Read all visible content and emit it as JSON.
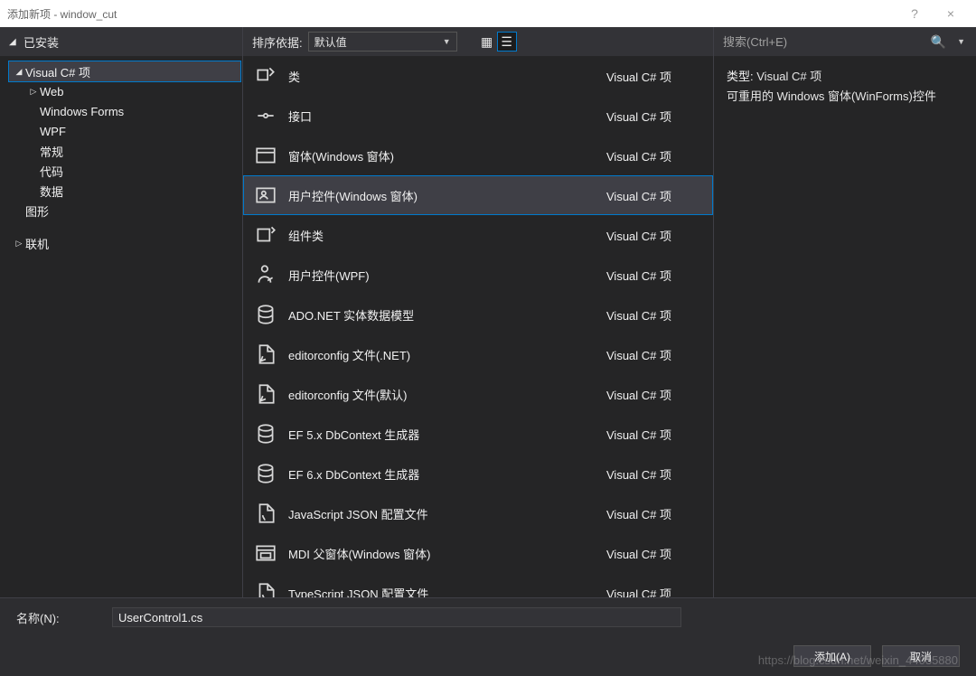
{
  "window": {
    "title": "添加新项 - window_cut",
    "help": "?",
    "close": "×"
  },
  "left": {
    "installed_header": "已安装",
    "nodes": [
      {
        "label": "Visual C# 项",
        "indent": 0,
        "caret": "down",
        "selected": true
      },
      {
        "label": "Web",
        "indent": 1,
        "caret": "right"
      },
      {
        "label": "Windows Forms",
        "indent": 1,
        "caret": ""
      },
      {
        "label": "WPF",
        "indent": 1,
        "caret": ""
      },
      {
        "label": "常规",
        "indent": 1,
        "caret": ""
      },
      {
        "label": "代码",
        "indent": 1,
        "caret": ""
      },
      {
        "label": "数据",
        "indent": 1,
        "caret": ""
      },
      {
        "label": "图形",
        "indent": 0,
        "caret": ""
      },
      {
        "label": "联机",
        "indent": -1,
        "caret": "right"
      }
    ]
  },
  "toolbar": {
    "sort_label": "排序依据:",
    "sort_value": "默认值"
  },
  "templates": {
    "type_label": "Visual C# 项",
    "items": [
      {
        "name": "类",
        "icon": "class"
      },
      {
        "name": "接口",
        "icon": "interface"
      },
      {
        "name": "窗体(Windows 窗体)",
        "icon": "form"
      },
      {
        "name": "用户控件(Windows 窗体)",
        "icon": "usercontrol",
        "selected": true
      },
      {
        "name": "组件类",
        "icon": "component"
      },
      {
        "name": "用户控件(WPF)",
        "icon": "usercontrol-wpf"
      },
      {
        "name": "ADO.NET 实体数据模型",
        "icon": "ado"
      },
      {
        "name": "editorconfig 文件(.NET)",
        "icon": "editorconfig"
      },
      {
        "name": "editorconfig 文件(默认)",
        "icon": "editorconfig"
      },
      {
        "name": "EF 5.x DbContext 生成器",
        "icon": "ef"
      },
      {
        "name": "EF 6.x DbContext 生成器",
        "icon": "ef"
      },
      {
        "name": "JavaScript JSON 配置文件",
        "icon": "json"
      },
      {
        "name": "MDI 父窗体(Windows 窗体)",
        "icon": "mdi"
      },
      {
        "name": "TypeScript JSON 配置文件",
        "icon": "json"
      }
    ]
  },
  "search": {
    "placeholder": "搜索(Ctrl+E)"
  },
  "detail": {
    "type_prefix": "类型:",
    "type_value": "Visual C# 项",
    "description": "可重用的 Windows 窗体(WinForms)控件"
  },
  "footer": {
    "name_label": "名称(N):",
    "name_value": "UserControl1.cs",
    "add_btn": "添加(A)",
    "cancel_btn": "取消"
  },
  "watermark": "https://blog.csdn.net/weixin_44035880"
}
